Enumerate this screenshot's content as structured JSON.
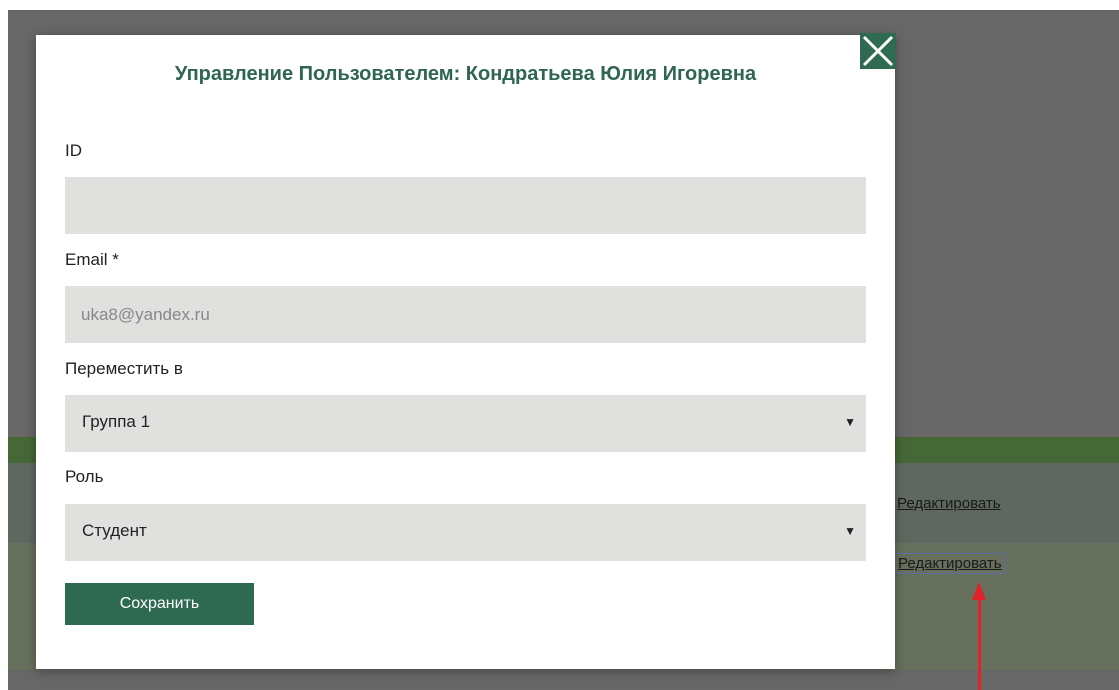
{
  "background": {
    "edit_link_1": "Редактировать",
    "edit_link_2": "Редактировать"
  },
  "modal": {
    "title": "Управление Пользователем: Кондратьева Юлия Игоревна",
    "close_icon": "close-x-icon",
    "fields": {
      "id_label": "ID",
      "id_value": "",
      "email_label": "Email *",
      "email_value": "uka8@yandex.ru",
      "move_label": "Переместить в",
      "move_selected": "Группа 1",
      "role_label": "Роль",
      "role_selected": "Студент"
    },
    "save_label": "Сохранить"
  },
  "colors": {
    "accent": "#2e6a52",
    "annotation_arrow": "#e1232a"
  }
}
